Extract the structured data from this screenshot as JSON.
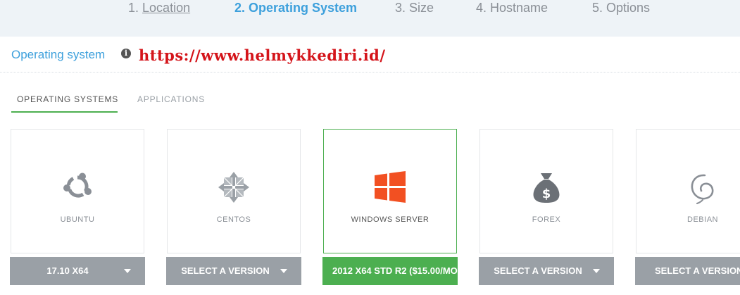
{
  "steps": [
    {
      "num": "1.",
      "label": "Location"
    },
    {
      "num": "",
      "label": "2. Operating System"
    },
    {
      "num": "",
      "label": "3. Size"
    },
    {
      "num": "",
      "label": "4. Hostname"
    },
    {
      "num": "",
      "label": "5. Options"
    }
  ],
  "section": {
    "title": "Operating system",
    "info_icon": "info-icon",
    "watermark": "https://www.helmykkediri.id/"
  },
  "tabs": [
    {
      "label": "OPERATING SYSTEMS",
      "active": true
    },
    {
      "label": "APPLICATIONS",
      "active": false
    }
  ],
  "os_cards": [
    {
      "name": "UBUNTU",
      "icon": "ubuntu-logo-icon",
      "version": "17.10 X64",
      "selected": false
    },
    {
      "name": "CENTOS",
      "icon": "centos-logo-icon",
      "version": "SELECT A VERSION",
      "selected": false
    },
    {
      "name": "WINDOWS SERVER",
      "icon": "windows-logo-icon",
      "version": "2012 X64 STD R2 ($15.00/MO",
      "selected": true
    },
    {
      "name": "FOREX",
      "icon": "money-bag-icon",
      "version": "SELECT A VERSION",
      "selected": false
    },
    {
      "name": "DEBIAN",
      "icon": "debian-swirl-icon",
      "version": "SELECT A VERSION",
      "selected": false
    }
  ],
  "colors": {
    "accent_blue": "#3da0dc",
    "selected_green": "#4caf50",
    "button_gray": "#9aa0a6",
    "watermark_red": "#d4141a",
    "windows_orange": "#f25022"
  }
}
